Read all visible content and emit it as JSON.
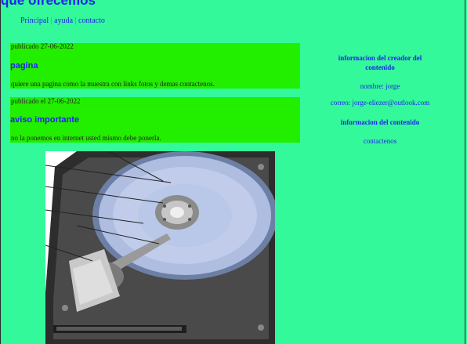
{
  "header": {
    "title": "que ofrecemos"
  },
  "nav": {
    "items": [
      "Principal",
      "ayuda",
      "contacto"
    ],
    "separator": "|"
  },
  "posts": [
    {
      "date": "publicado 27-06-2022",
      "title": "pagina",
      "text": "quiere una pagina como la muestra con links fotos y demas contactenos."
    },
    {
      "date": "publicado el 27-06-2022",
      "title": "aviso importante",
      "text": "no la ponemos en internet usted mismo debe ponerla."
    }
  ],
  "sidebar": {
    "creator_heading": "informacion del creador del contenido",
    "name_line": "nombre: jorge",
    "email_line": "correo: jorge-eliezer@outlook.com",
    "content_heading": "informacion del contenido",
    "contact_link": "contactenos"
  },
  "colors": {
    "background": "#33f99a",
    "post_background": "#22ee00",
    "link": "#2222ee"
  },
  "image": {
    "subject": "hard-disk-drive-illustration"
  }
}
